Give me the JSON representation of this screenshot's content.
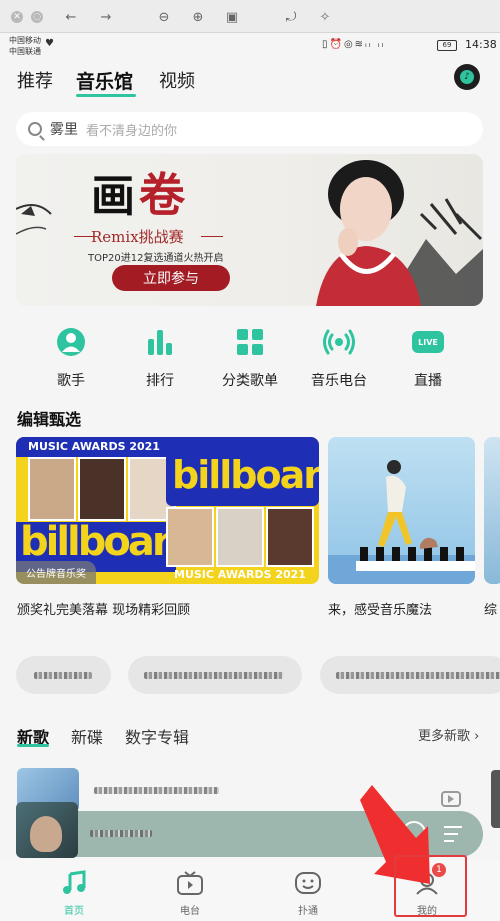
{
  "status": {
    "carrier1": "中国移动",
    "carrier2": "中国联通",
    "battery": "69",
    "time": "14:38"
  },
  "top_tabs": [
    {
      "label": "推荐"
    },
    {
      "label": "音乐馆"
    },
    {
      "label": "视频"
    }
  ],
  "search": {
    "keyword": "雾里",
    "hint": "看不清身边的你"
  },
  "banner": {
    "title_black": "画",
    "title_red": "卷",
    "subtitle": "Remix挑战赛",
    "info": "TOP20进12复选通道火热开启",
    "cta": "立即参与"
  },
  "categories": [
    {
      "label": "歌手",
      "icon": "singer-icon"
    },
    {
      "label": "排行",
      "icon": "chart-icon"
    },
    {
      "label": "分类歌单",
      "icon": "grid-icon"
    },
    {
      "label": "音乐电台",
      "icon": "radio-icon"
    },
    {
      "label": "直播",
      "icon": "live-icon"
    }
  ],
  "live_badge": "LIVE",
  "editor_section": {
    "title": "编辑甄选",
    "cards": [
      {
        "caption": "颁奖礼完美落幕 现场精彩回顾",
        "tag": "公告牌音乐奖",
        "header": "MUSIC AWARDS 2021",
        "brand": "billboard",
        "footer": "MUSIC AWARDS 2021"
      },
      {
        "caption": "来，感受音乐魔法"
      },
      {
        "caption": "综"
      }
    ]
  },
  "new_section": {
    "tabs": [
      {
        "label": "新歌"
      },
      {
        "label": "新碟"
      },
      {
        "label": "数字专辑"
      }
    ],
    "more": "更多新歌"
  },
  "bottom_nav": [
    {
      "label": "首页",
      "icon": "music-note-icon",
      "active": true
    },
    {
      "label": "电台",
      "icon": "tv-icon",
      "active": false
    },
    {
      "label": "扑通",
      "icon": "chat-icon",
      "active": false
    },
    {
      "label": "我的",
      "icon": "profile-icon",
      "active": false,
      "badge": "1"
    }
  ],
  "colors": {
    "accent": "#2ec4a0",
    "annotation_red": "#e23b3b",
    "banner_red": "#a31c24"
  }
}
